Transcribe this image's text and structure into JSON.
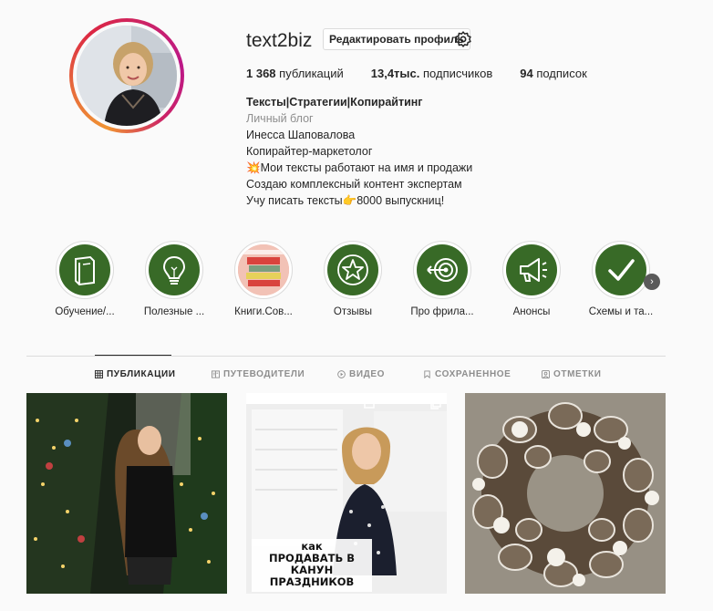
{
  "profile": {
    "username": "text2biz",
    "edit_button": "Редактировать профиль",
    "stats": [
      {
        "value": "1 368",
        "label": "публикаций"
      },
      {
        "value": "13,4тыс.",
        "label": "подписчиков"
      },
      {
        "value": "94",
        "label": "подписок"
      }
    ],
    "bio": {
      "name": "Тексты|Стратегии|Копирайтинг",
      "category": "Личный блог",
      "lines": [
        "Инесса Шаповалова",
        "Копирайтер-маркетолог",
        "💥Мои тексты работают на имя и продажи",
        "Создаю комплексный контент экспертам",
        "Учу писать тексты👉8000 выпускниц!"
      ]
    }
  },
  "highlights": [
    {
      "label": "Обучение/...",
      "icon": "book-icon"
    },
    {
      "label": "Полезные ...",
      "icon": "lightbulb-icon"
    },
    {
      "label": "Книги.Сов...",
      "icon": "books-photo"
    },
    {
      "label": "Отзывы",
      "icon": "star-icon"
    },
    {
      "label": "Про фрила...",
      "icon": "target-icon"
    },
    {
      "label": "Анонсы",
      "icon": "megaphone-icon"
    },
    {
      "label": "Схемы и та...",
      "icon": "checkmark-icon"
    }
  ],
  "tabs": [
    {
      "label": "ПУБЛИКАЦИИ",
      "icon": "grid-icon",
      "active": true
    },
    {
      "label": "ПУТЕВОДИТЕЛИ",
      "icon": "guide-icon",
      "active": false
    },
    {
      "label": "ВИДЕО",
      "icon": "play-icon",
      "active": false
    },
    {
      "label": "СОХРАНЕННОЕ",
      "icon": "bookmark-icon",
      "active": false
    },
    {
      "label": "ОТМЕТКИ",
      "icon": "tag-icon",
      "active": false
    }
  ],
  "posts": [
    {
      "caption": ""
    },
    {
      "caption_lines": [
        "как",
        "ПРОДАВАТЬ В",
        "КАНУН",
        "ПРАЗДНИКОВ"
      ]
    },
    {
      "caption": ""
    }
  ],
  "colors": {
    "highlight_green": "#386a27",
    "ring_gradient": [
      "#f09433",
      "#dc2743",
      "#bc1888"
    ],
    "text": "#262626",
    "muted": "#8e8e8e"
  }
}
